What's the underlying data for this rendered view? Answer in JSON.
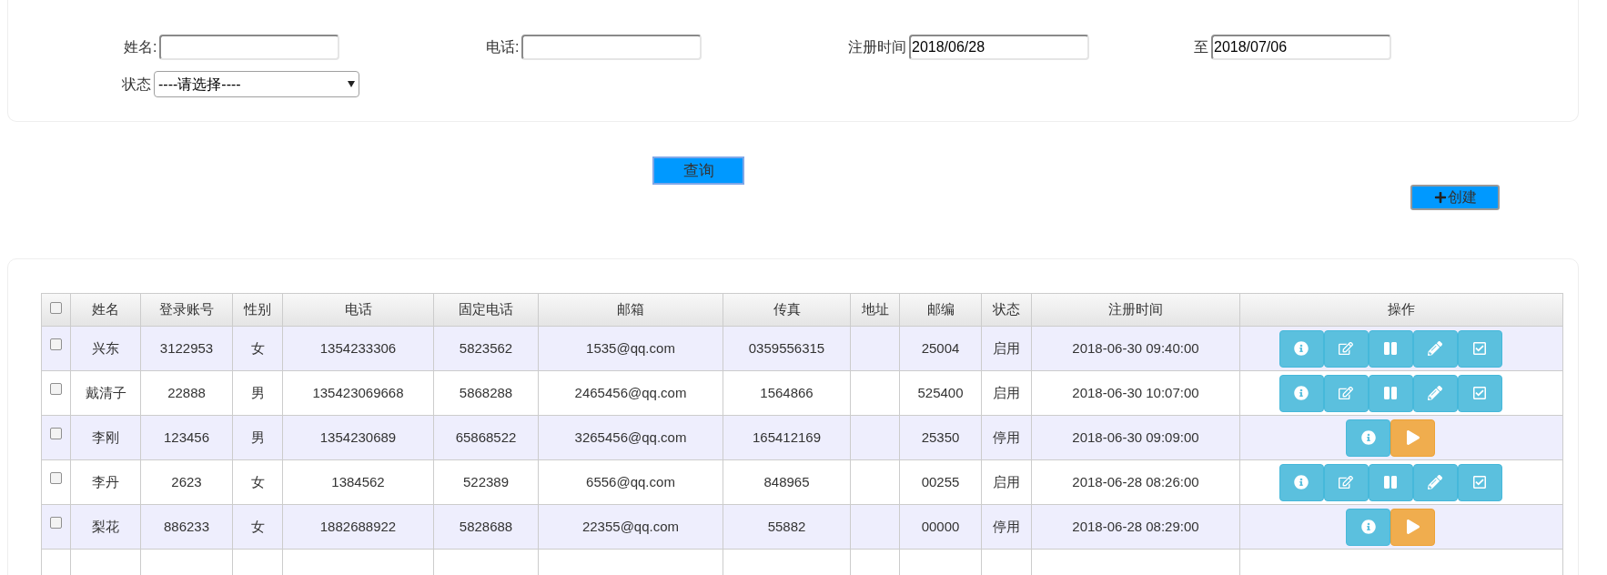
{
  "search_form": {
    "fields": [
      {
        "label": "姓名:",
        "kind": "text"
      },
      {
        "label": "电话:",
        "kind": "text"
      },
      {
        "label": "注册时间",
        "value": "2018/06/28",
        "kind": "text"
      },
      {
        "label": "至",
        "value": "2018/07/06",
        "kind": "text"
      },
      {
        "label": "状态",
        "value": "----请选择----",
        "kind": "select"
      }
    ]
  },
  "query_button": "查询",
  "create_button": "创建",
  "table": {
    "select_all": {
      "checked": false
    },
    "columns": [
      "姓名",
      "登录账号",
      "性别",
      "电话",
      "固定电话",
      "邮箱",
      "传真",
      "地址",
      "邮编",
      "状态",
      "注册时间",
      "操作"
    ],
    "rows": [
      {
        "checked": false,
        "cells": [
          "兴东",
          "3122953",
          "女",
          "1354233306",
          "5823562",
          "1535@qq.com",
          "0359556315",
          null,
          "25004",
          "启用",
          "2018-06-30 09:40:00"
        ],
        "actions": [
          {
            "kind": "info"
          },
          {
            "kind": "edit"
          },
          {
            "kind": "pause"
          },
          {
            "kind": "pencil"
          },
          {
            "kind": "check"
          }
        ]
      },
      {
        "checked": false,
        "cells": [
          "戴清子",
          "22888",
          "男",
          "135423069668",
          "5868288",
          "2465456@qq.com",
          "1564866",
          null,
          "525400",
          "启用",
          "2018-06-30 10:07:00"
        ],
        "actions": [
          {
            "kind": "info"
          },
          {
            "kind": "edit"
          },
          {
            "kind": "pause"
          },
          {
            "kind": "pencil"
          },
          {
            "kind": "check"
          }
        ]
      },
      {
        "checked": false,
        "cells": [
          "李刚",
          "123456",
          "男",
          "1354230689",
          "65868522",
          "3265456@qq.com",
          "165412169",
          null,
          "25350",
          "停用",
          "2018-06-30 09:09:00"
        ],
        "actions": [
          {
            "kind": "info"
          },
          {
            "kind": "play"
          }
        ]
      },
      {
        "checked": false,
        "cells": [
          "李丹",
          "2623",
          "女",
          "1384562",
          "522389",
          "6556@qq.com",
          "848965",
          null,
          "00255",
          "启用",
          "2018-06-28 08:26:00"
        ],
        "actions": [
          {
            "kind": "info"
          },
          {
            "kind": "edit"
          },
          {
            "kind": "pause"
          },
          {
            "kind": "pencil"
          },
          {
            "kind": "check"
          }
        ]
      },
      {
        "checked": false,
        "cells": [
          "梨花",
          "886233",
          "女",
          "1882688922",
          "5828688",
          "22355@qq.com",
          "55882",
          null,
          "00000",
          "停用",
          "2018-06-28 08:29:00"
        ],
        "actions": [
          {
            "kind": "info"
          },
          {
            "kind": "play"
          }
        ]
      }
    ]
  }
}
